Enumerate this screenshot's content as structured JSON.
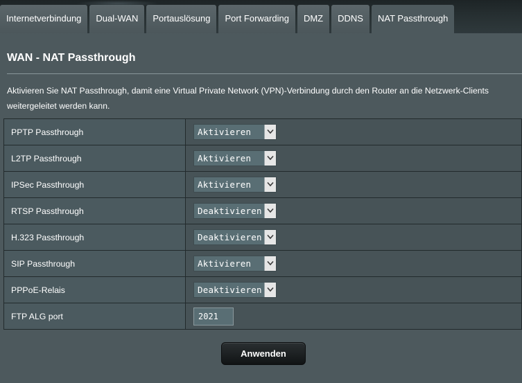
{
  "tabs": [
    {
      "label": "Internetverbindung",
      "active": false
    },
    {
      "label": "Dual-WAN",
      "active": false
    },
    {
      "label": "Portauslösung",
      "active": false
    },
    {
      "label": "Port Forwarding",
      "active": false
    },
    {
      "label": "DMZ",
      "active": false
    },
    {
      "label": "DDNS",
      "active": false
    },
    {
      "label": "NAT Passthrough",
      "active": true
    }
  ],
  "page": {
    "title": "WAN - NAT Passthrough",
    "description": "Aktivieren Sie NAT Passthrough, damit eine Virtual Private Network (VPN)-Verbindung durch den Router an die Netzwerk-Clients weitergeleitet werden kann."
  },
  "settings": [
    {
      "label": "PPTP Passthrough",
      "value": "Aktivieren"
    },
    {
      "label": "L2TP Passthrough",
      "value": "Aktivieren"
    },
    {
      "label": "IPSec Passthrough",
      "value": "Aktivieren"
    },
    {
      "label": "RTSP Passthrough",
      "value": "Deaktivieren"
    },
    {
      "label": "H.323 Passthrough",
      "value": "Deaktivieren"
    },
    {
      "label": "SIP Passthrough",
      "value": "Aktivieren"
    },
    {
      "label": "PPPoE-Relais",
      "value": "Deaktivieren"
    }
  ],
  "ftp_alg": {
    "label": "FTP ALG port",
    "value": "2021"
  },
  "apply_label": "Anwenden",
  "icons": {
    "dropdown": "chevron-down-icon"
  },
  "colors": {
    "background": "#4d595d",
    "tab_bg": "#5b666a",
    "label_cell": "#4b5a5f",
    "value_cell": "#475357",
    "button": "#1a1e20"
  }
}
